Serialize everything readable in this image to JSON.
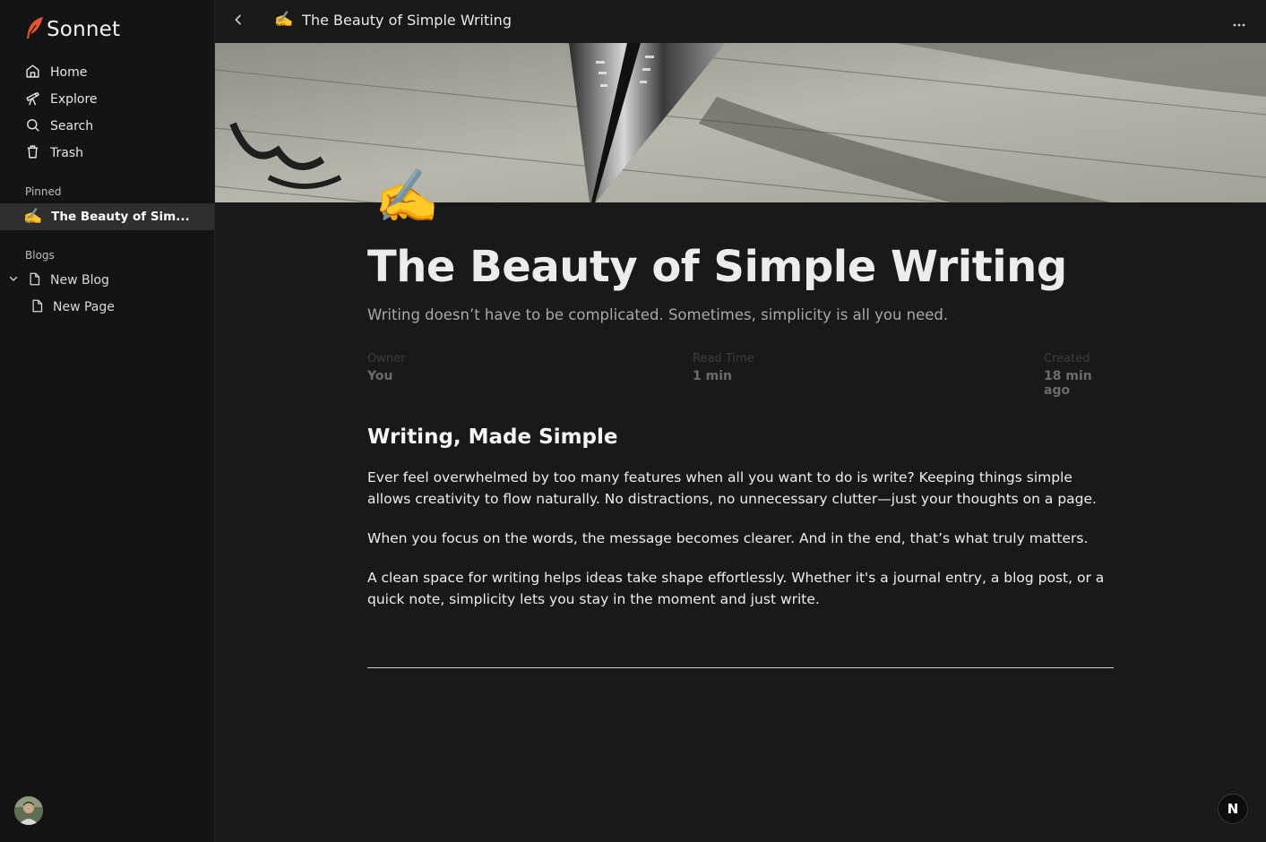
{
  "brand": {
    "name": "Sonnet",
    "logo_icon": "feather-icon"
  },
  "sidebar": {
    "nav": [
      {
        "label": "Home",
        "icon": "home-icon"
      },
      {
        "label": "Explore",
        "icon": "telescope-icon"
      },
      {
        "label": "Search",
        "icon": "search-icon"
      },
      {
        "label": "Trash",
        "icon": "trash-icon"
      }
    ],
    "pinned_label": "Pinned",
    "pinned_items": [
      {
        "label": "The Beauty of Sim...",
        "emoji": "✍️"
      }
    ],
    "blogs_label": "Blogs",
    "blogs": [
      {
        "label": "New Blog",
        "icon": "page-icon",
        "expanded": true
      },
      {
        "label": "New Page",
        "icon": "page-icon"
      }
    ]
  },
  "topbar": {
    "emoji": "✍️",
    "doc_title": "The Beauty of Simple Writing",
    "back_icon": "chevron-left-icon",
    "more_icon": "ellipsis-icon"
  },
  "document": {
    "emoji": "✍️",
    "title": "The Beauty of Simple Writing",
    "subtitle": "Writing doesn’t have to be complicated. Sometimes, simplicity is all you need.",
    "meta": {
      "owner_label": "Owner",
      "owner_value": "You",
      "read_label": "Read Time",
      "read_value": "1 min",
      "created_label": "Created",
      "created_value": "18 min ago"
    },
    "heading": "Writing, Made Simple",
    "paragraphs": [
      "Ever feel overwhelmed by too many features when all you want to do is write? Keeping things simple allows creativity to flow naturally. No distractions, no unnecessary clutter—just your thoughts on a page.",
      "When you focus on the words, the message becomes clearer. And in the end, that’s what truly matters.",
      "A clean space for writing helps ideas take shape effortlessly. Whether it's a journal entry, a blog post, or a quick note, simplicity lets you stay in the moment and just write."
    ]
  },
  "fab": {
    "label": "N"
  },
  "colors": {
    "accent": "#e8552a",
    "background": "#191919",
    "sidebar": "#141414",
    "selected": "#2f2f2f"
  }
}
